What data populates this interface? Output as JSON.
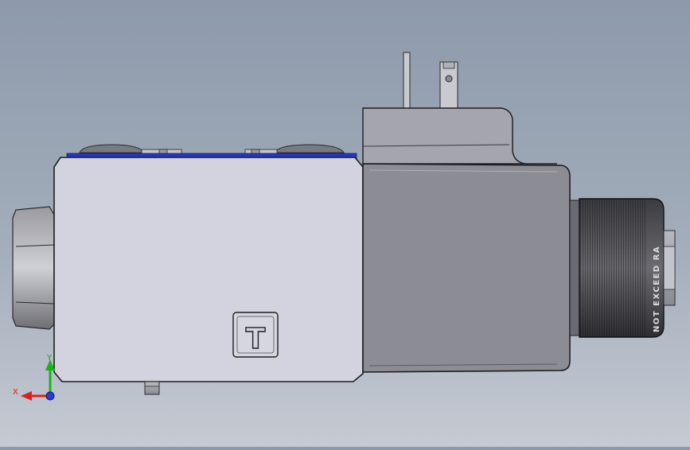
{
  "model": {
    "port_label": "T",
    "knob_text": "NOT EXCEED RA"
  },
  "axes": {
    "x_label": "X",
    "y_label": "Y"
  },
  "colors": {
    "x_axis": "#e02020",
    "y_axis": "#19b319",
    "z_axis": "#2a3bd6",
    "seal_strip": "#2438c8",
    "valve_body": "#d2d3de",
    "coil_body": "#8c8c94"
  }
}
